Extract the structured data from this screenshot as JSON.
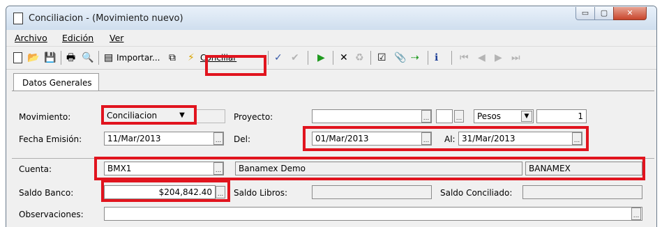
{
  "window": {
    "title": "Conciliacion - (Movimiento nuevo)",
    "min_glyph": "▭",
    "max_glyph": "▢",
    "close_glyph": "✕"
  },
  "menu": [
    "Archivo",
    "Edición",
    "Ver"
  ],
  "toolbar": {
    "importar_label": "Importar...",
    "conciliar_label": "Conciliar",
    "new_glyph": "🗋",
    "open_glyph": "📂",
    "save_glyph": "💾",
    "print_glyph": "🖶",
    "preview_glyph": "🔍",
    "import_glyph": "▤",
    "copy_glyph": "⧉",
    "lightning_glyph": "⚡",
    "spell_glyph": "✓",
    "check_glyph": "✔",
    "play_glyph": "▶",
    "delete_glyph": "✕",
    "trash_glyph": "♻",
    "clipboard_glyph": "☑",
    "clip_glyph": "📎",
    "export_glyph": "⇢",
    "info_glyph": "ℹ",
    "first_glyph": "⏮",
    "prev_glyph": "◀",
    "next_glyph": "▶",
    "last_glyph": "⏭"
  },
  "tabs": [
    "Datos Generales"
  ],
  "form": {
    "movimiento_label": "Movimiento:",
    "movimiento_value": "Conciliacion",
    "proyecto_label": "Proyecto:",
    "moneda": "Pesos",
    "tipo_cambio": "1",
    "fecha_emision_label": "Fecha Emisión:",
    "fecha_emision": "11/Mar/2013",
    "del_label": "Del:",
    "del_value": "01/Mar/2013",
    "al_label": "Al:",
    "al_value": "31/Mar/2013",
    "cuenta_label": "Cuenta:",
    "cuenta": "BMX1",
    "cuenta_nombre": "Banamex Demo",
    "banco": "BANAMEX",
    "saldo_banco_label": "Saldo Banco:",
    "saldo_banco": "$204,842.40",
    "saldo_libros_label": "Saldo Libros:",
    "saldo_conciliado_label": "Saldo Conciliado:",
    "observaciones_label": "Observaciones:",
    "ellipsis": "...",
    "dropdown_glyph": "▼"
  },
  "colors": {
    "highlight": "#e1141e",
    "field_bg": "#ffffff",
    "window_bg": "#f0f0f0"
  }
}
